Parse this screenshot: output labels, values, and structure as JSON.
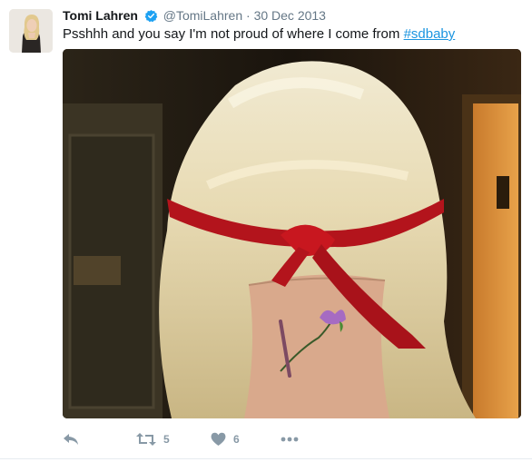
{
  "tweet": {
    "display_name": "Tomi Lahren",
    "handle": "@TomiLahren",
    "separator": "·",
    "date": "30 Dec 2013",
    "text": "Psshhh and you say I'm not proud of where I come from ",
    "hashtag": "#sdbaby",
    "verified": true
  },
  "actions": {
    "reply_icon": "reply-icon",
    "retweet_icon": "retweet-icon",
    "retweet_count": "5",
    "like_icon": "heart-icon",
    "like_count": "6",
    "more_icon": "more-dots-icon"
  },
  "colors": {
    "link": "#1b95e0",
    "verified_badge": "#1da1f2",
    "action_grey": "#8899a6"
  }
}
